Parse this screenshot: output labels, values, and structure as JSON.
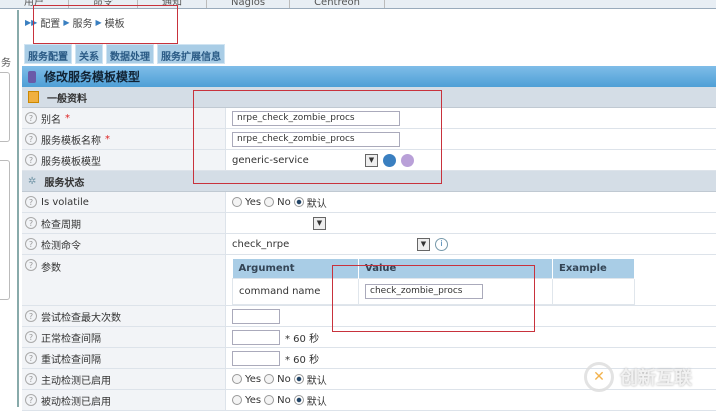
{
  "topnav": [
    "用户",
    "命令",
    "通知",
    "Nagios",
    "Centreon"
  ],
  "sidebar": {
    "partial_text": "务"
  },
  "breadcrumb": [
    "配置",
    "服务",
    "模板"
  ],
  "tabs": [
    "服务配置",
    "关系",
    "数据处理",
    "服务扩展信息"
  ],
  "form": {
    "title": "修改服务模板模型",
    "section_general": "一般资料",
    "alias": {
      "label": "别名",
      "required": "*",
      "value": "nrpe_check_zombie_procs"
    },
    "name": {
      "label": "服务模板名称",
      "required": "*",
      "value": "nrpe_check_zombie_procs"
    },
    "template": {
      "label": "服务模板模型",
      "value": "generic-service"
    },
    "section_state": "服务状态",
    "volatile": {
      "label": "Is volatile",
      "opts": [
        "Yes",
        "No",
        "默认"
      ]
    },
    "check_period": {
      "label": "检查周期",
      "value": ""
    },
    "check_command": {
      "label": "检测命令",
      "value": "check_nrpe"
    },
    "args": {
      "label": "参数",
      "headers": [
        "Argument",
        "Value",
        "Example"
      ],
      "row": {
        "argument": "command name",
        "value": "check_zombie_procs",
        "example": ""
      }
    },
    "max_attempts": {
      "label": "尝试检查最大次数",
      "value": ""
    },
    "normal_interval": {
      "label": "正常检查间隔",
      "value": "",
      "unit": "* 60 秒"
    },
    "retry_interval": {
      "label": "重试检查间隔",
      "value": "",
      "unit": "* 60 秒"
    },
    "active": {
      "label": "主动检测已启用",
      "opts": [
        "Yes",
        "No",
        "默认"
      ]
    },
    "passive": {
      "label": "被动检测已启用",
      "opts": [
        "Yes",
        "No",
        "默认"
      ]
    }
  },
  "watermark": "创新互联"
}
